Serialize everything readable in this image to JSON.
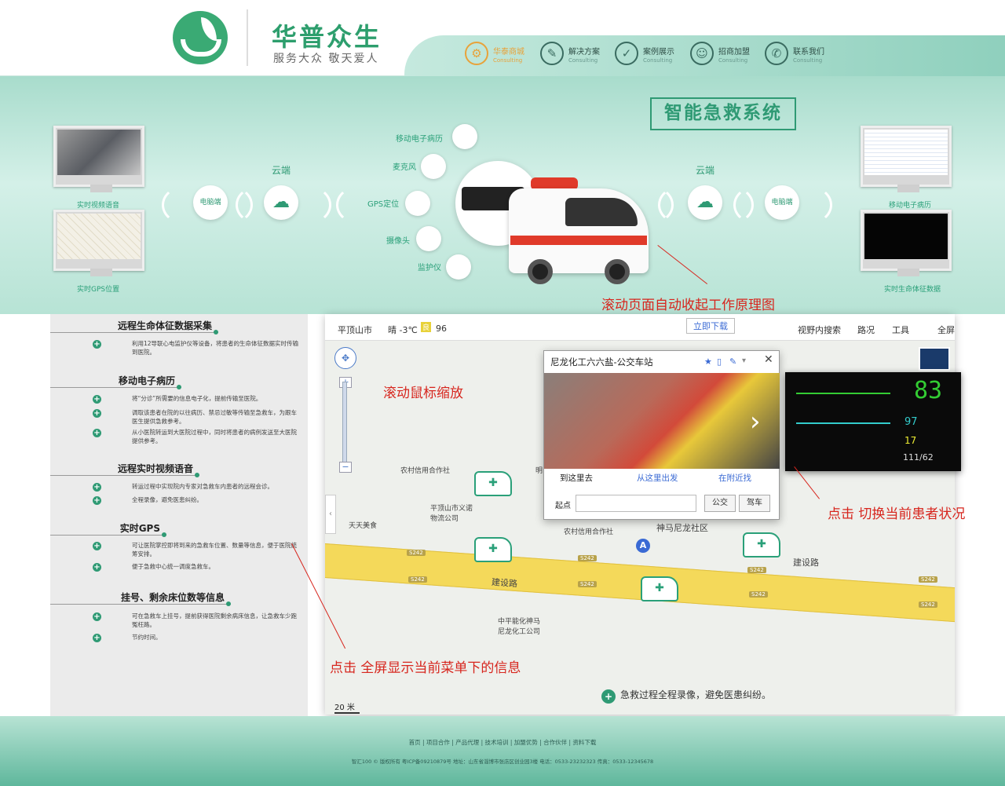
{
  "brand": {
    "name": "华普众生",
    "slogan": "服务大众  敬天爱人"
  },
  "nav": [
    {
      "label": "华泰商城",
      "sub": "Consulting",
      "icon": "gear-icon",
      "active": true
    },
    {
      "label": "解决方案",
      "sub": "Consulting",
      "icon": "pen-icon",
      "active": false
    },
    {
      "label": "案例展示",
      "sub": "Consulting",
      "icon": "check-icon",
      "active": false
    },
    {
      "label": "招商加盟",
      "sub": "Consulting",
      "icon": "user-icon",
      "active": false
    },
    {
      "label": "联系我们",
      "sub": "Consulting",
      "icon": "phone-icon",
      "active": false
    }
  ],
  "hero": {
    "title": "智能急救系统",
    "left_monitors": [
      "实时视频语音",
      "实时GPS位置"
    ],
    "right_monitors": [
      "移动电子病历",
      "实时生命体征数据"
    ],
    "computer_node": "电脑端",
    "cloud_label": "云端",
    "devices": [
      "移动电子病历",
      "麦克风",
      "GPS定位",
      "摄像头",
      "监护仪"
    ],
    "note": "滚动页面自动收起工作原理图"
  },
  "sidebar": [
    {
      "title": "远程生命体征数据采集",
      "items": [
        "利用12导联心电监护仪等设备，将患者的生命体征数据实时传输到医院。"
      ]
    },
    {
      "title": "移动电子病历",
      "items": [
        "将“分诊”所需要的信息电子化，提前传输至医院。",
        "调取该患者在院的以往病历、禁忌过敏等传输至急救车，为跟车医生提供急救参考。",
        "从小医院转运到大医院过程中，同时将患者的病例发送至大医院提供参考。"
      ]
    },
    {
      "title": "远程实时视频语音",
      "items": [
        "转运过程中实现院内专家对急救车内患者的远程会诊。",
        "全程录像，避免医患纠纷。"
      ]
    },
    {
      "title": "实时GPS",
      "items": [
        "可让医院掌控即将到来的急救车位置、数量等信息，便于医院统筹安排。",
        "便于急救中心统一调度急救车。"
      ]
    },
    {
      "title": "挂号、剩余床位数等信息",
      "items": [
        "可在急救车上挂号，提前获得医院剩余病床信息，让急救车少跑冤枉路。",
        "节约时间。"
      ]
    }
  ],
  "map": {
    "city": "平顶山市",
    "weather": "晴 -3℃",
    "aqi_badge": "良",
    "aqi": "96",
    "download": "立即下载",
    "tools": [
      "视野内搜索",
      "路况",
      "工具",
      "全屏"
    ],
    "zoom_note": "滚动鼠标缩放",
    "labels": [
      "农村信用合作社",
      "平顶山市义诺物流公司",
      "天天美食",
      "农村信用合作社",
      "神马尼龙社区",
      "建设路",
      "建设路",
      "中平能化神马尼龙化工公司",
      "明"
    ],
    "road_signs": [
      "S242",
      "S242",
      "S242",
      "S242",
      "S242",
      "S242",
      "S242",
      "S242"
    ],
    "scale": "20 米",
    "bottom_note": "急救过程全程录像，避免医患纠纷。",
    "marker": "A"
  },
  "popup": {
    "title": "尼龙化工六六盐-公交车站",
    "tabs": [
      "到这里去",
      "从这里出发",
      "在附近找"
    ],
    "start_label": "起点",
    "start_value": "",
    "bus_button": "公交",
    "drive_button": "驾车"
  },
  "vitals": {
    "hr": "83",
    "spo2": "97",
    "small": "17",
    "bp": "111/62"
  },
  "notes": {
    "switch": "点击 切换当前患者状况",
    "fullscreen": "点击 全屏显示当前菜单下的信息"
  },
  "footer": {
    "links": "首页 | 项目合作 | 产品代理 | 技术培训 | 加盟优势 | 合作伙伴 | 资料下载",
    "info": "智汇100 © 版权所有  粤ICP备09210879号  地址：山东省淄博市张店区创业园3楼  电话：0533-23232323  传真：0533-12345678"
  },
  "colors": {
    "brand_green": "#2f9a74",
    "note_red": "#d7261e",
    "active_nav": "#e8a23a"
  }
}
